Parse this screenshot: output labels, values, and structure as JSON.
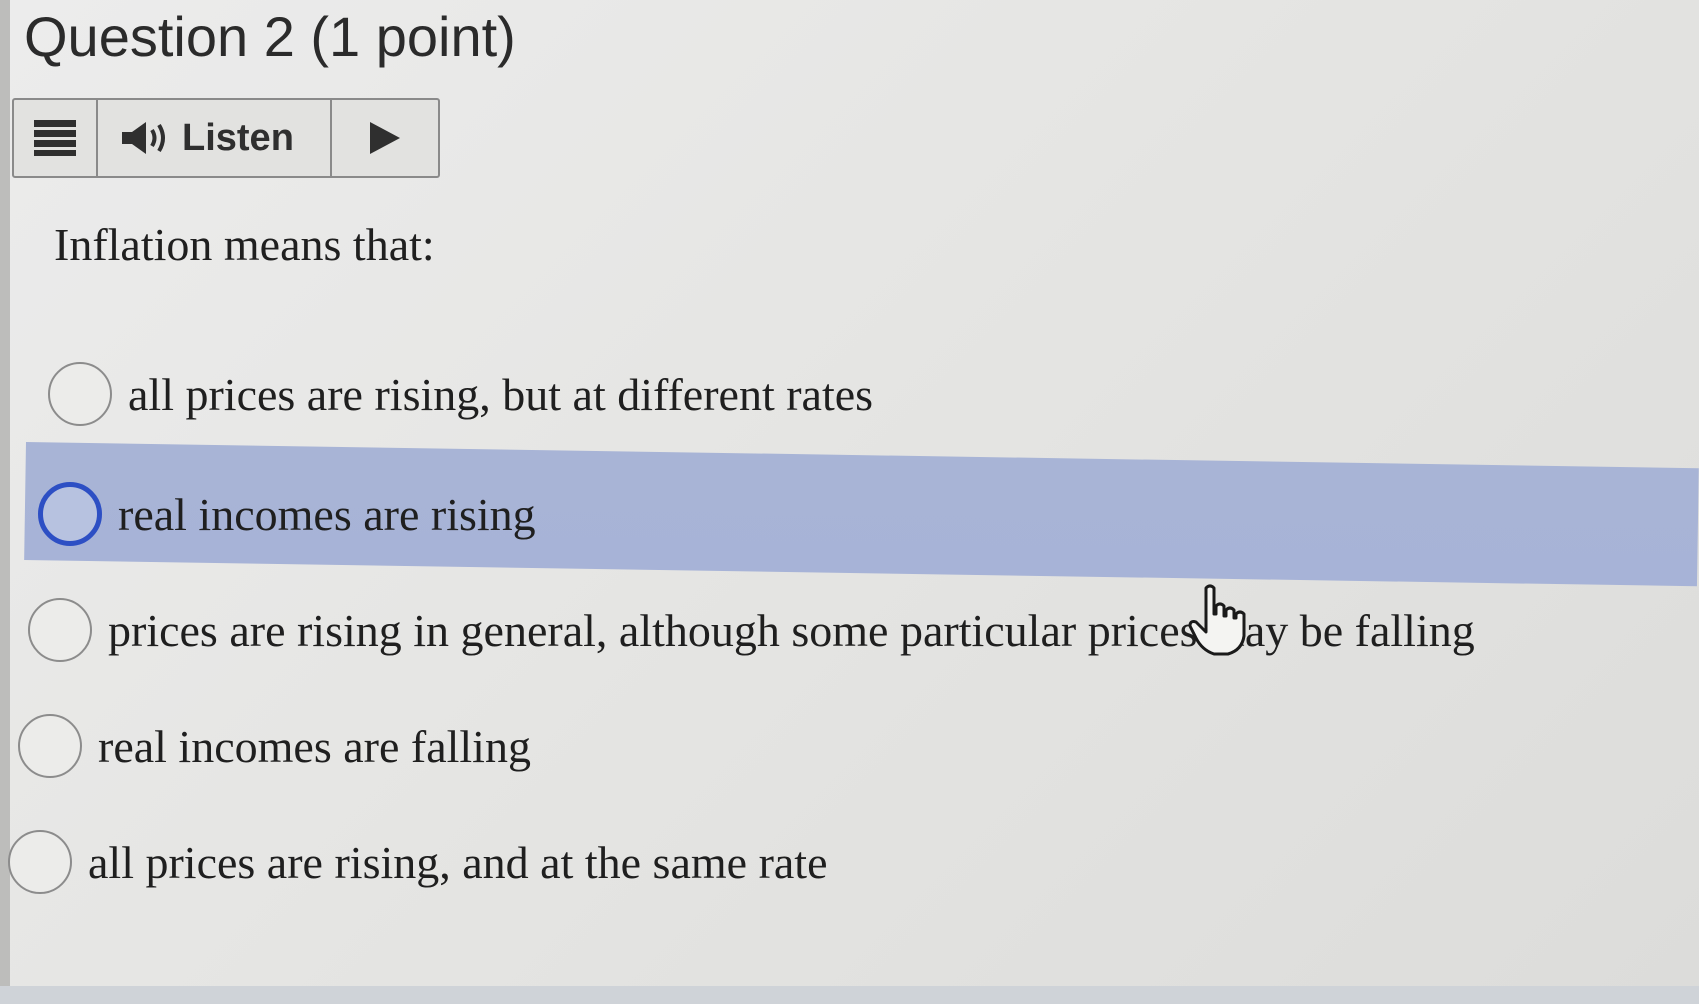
{
  "question": {
    "title": "Question 2 (1 point)"
  },
  "toolbar": {
    "menu_icon": "hamburger-menu-icon",
    "speaker_icon": "speaker-icon",
    "listen_label": "Listen",
    "play_icon": "play-icon"
  },
  "prompt": "Inflation means that:",
  "options": [
    {
      "label": "all prices are rising, but at different rates",
      "selected": false,
      "focused": false
    },
    {
      "label": "real incomes are rising",
      "selected": false,
      "focused": true
    },
    {
      "label": "prices are rising in general, although some particular prices may be falling",
      "selected": false,
      "focused": false
    },
    {
      "label": "real incomes are falling",
      "selected": false,
      "focused": false
    },
    {
      "label": "all prices are rising, and at the same rate",
      "selected": false,
      "focused": false
    }
  ],
  "colors": {
    "focus_ring": "#2d4fc4",
    "highlight": "#a8b4d6",
    "background": "#e8e8e6"
  },
  "cursor": {
    "icon": "hand-pointer-icon"
  }
}
